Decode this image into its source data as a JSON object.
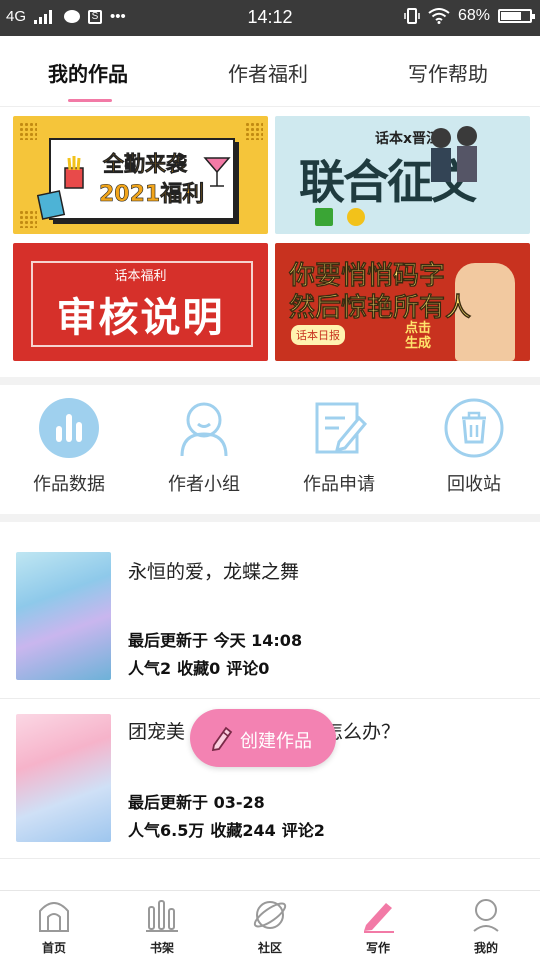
{
  "status_bar": {
    "network": "4G",
    "time": "14:12",
    "battery": "68%",
    "battery_level": 0.68,
    "icons": [
      "signal-icon",
      "message-icon",
      "s-icon",
      "more-icon",
      "vibrate-icon",
      "wifi-icon",
      "battery-icon"
    ]
  },
  "tabs": [
    {
      "label": "我的作品",
      "active": true
    },
    {
      "label": "作者福利",
      "active": false
    },
    {
      "label": "写作帮助",
      "active": false
    }
  ],
  "banners": {
    "banner1": {
      "line1": "全勤来袭",
      "line2": "2021福利"
    },
    "banner2": {
      "top": "话本x晋江",
      "main": "联合征文"
    },
    "banner3": {
      "small": "话本福利",
      "big": "审核说明"
    },
    "banner4": {
      "line1": "你要悄悄码字",
      "line2": "然后惊艳所有人",
      "tag": "话本日报",
      "cta": "点击生成"
    }
  },
  "quick_actions": [
    {
      "label": "作品数据",
      "icon": "bar-chart-icon"
    },
    {
      "label": "作者小组",
      "icon": "group-icon"
    },
    {
      "label": "作品申请",
      "icon": "edit-document-icon"
    },
    {
      "label": "回收站",
      "icon": "trash-icon"
    }
  ],
  "works": [
    {
      "title": "永恒的爱，龙蝶之舞",
      "updated": "最后更新于 今天 14:08",
      "popularity": "人气2",
      "favorites": "收藏0",
      "comments": "评论0"
    },
    {
      "title": "团宠美…………了怎么办？",
      "title_left": "团宠美",
      "title_right": "了怎么办？",
      "updated": "最后更新于 03-28",
      "popularity": "人气6.5万",
      "favorites": "收藏244",
      "comments": "评论2"
    }
  ],
  "fab": {
    "label": "创建作品",
    "icon": "pencil-icon"
  },
  "bottom_nav": [
    {
      "label": "首页",
      "icon": "home-icon"
    },
    {
      "label": "书架",
      "icon": "bookshelf-icon"
    },
    {
      "label": "社区",
      "icon": "planet-icon"
    },
    {
      "label": "写作",
      "icon": "pen-icon",
      "active": true
    },
    {
      "label": "我的",
      "icon": "profile-icon"
    }
  ],
  "colors": {
    "accent": "#f27aa6",
    "fab": "#f382b2",
    "icon_blue": "#9fd0ee"
  }
}
